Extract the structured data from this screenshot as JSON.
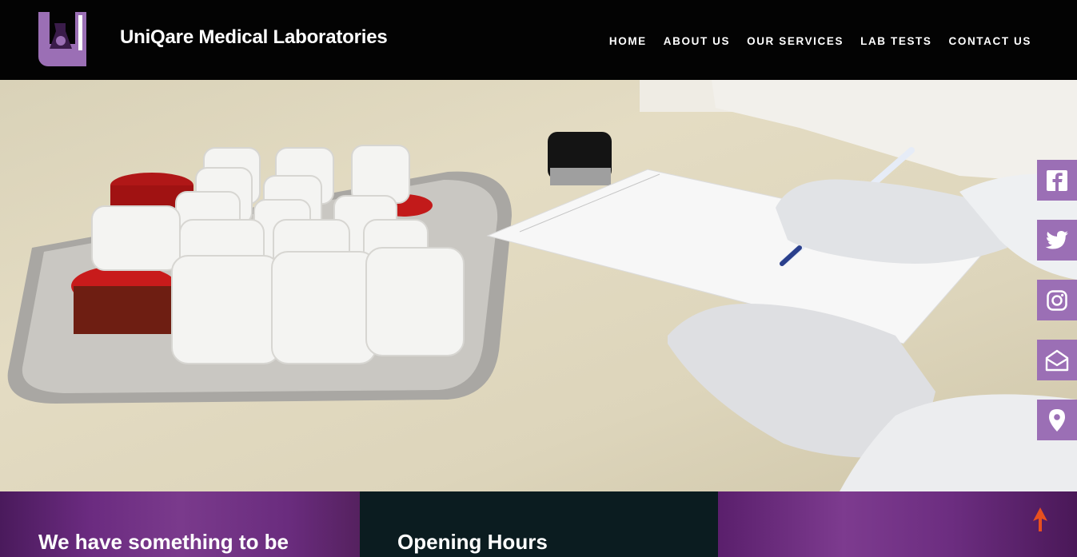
{
  "header": {
    "brand": "UniQare Medical Laboratories",
    "logo_icon": "lab-flask-logo-icon"
  },
  "nav": {
    "items": [
      {
        "label": "HOME"
      },
      {
        "label": "ABOUT US"
      },
      {
        "label": "OUR SERVICES"
      },
      {
        "label": "LAB TESTS"
      },
      {
        "label": "CONTACT US"
      }
    ]
  },
  "social": {
    "items": [
      {
        "icon": "facebook-icon"
      },
      {
        "icon": "twitter-icon"
      },
      {
        "icon": "instagram-icon"
      },
      {
        "icon": "mail-icon"
      },
      {
        "icon": "location-pin-icon"
      }
    ]
  },
  "sections": {
    "left_heading": "We have something to be",
    "mid_heading": "Opening Hours"
  },
  "colors": {
    "accent": "#9b6fb5",
    "header_bg": "#030303",
    "dark_panel": "#0b1c20",
    "purple_panel": "#6b2b80",
    "arrow": "#e8501f"
  }
}
